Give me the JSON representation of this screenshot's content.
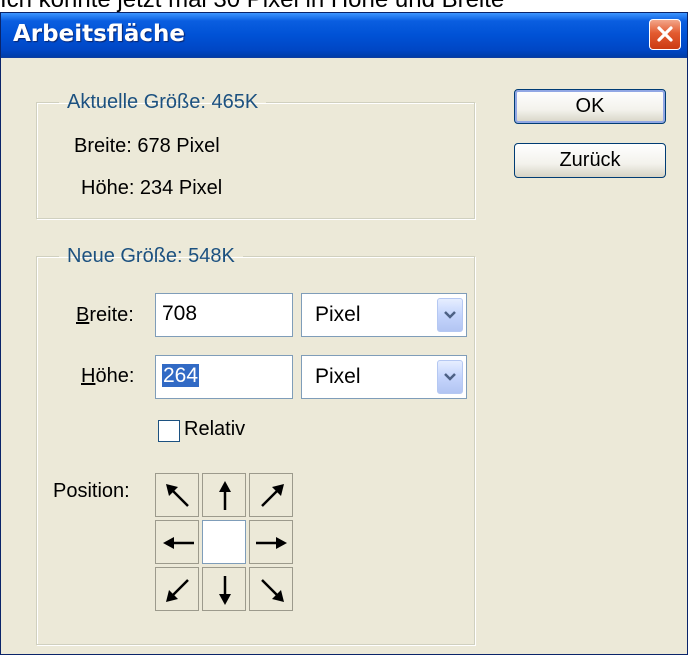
{
  "caption_partial": "Ich könnte jetzt mal 30 Pixel in Höhe und Breite",
  "dialog": {
    "title": "Arbeitsfläche",
    "close_icon": "close-x-icon"
  },
  "current_size": {
    "legend": "Aktuelle Größe: 465K",
    "width_text": "Breite: 678 Pixel",
    "height_text": "Höhe: 234 Pixel"
  },
  "new_size": {
    "legend": "Neue Größe: 548K",
    "width_label_mnemonic": "B",
    "width_label_rest": "reite:",
    "width_value": "708",
    "width_unit": "Pixel",
    "height_label_mnemonic": "H",
    "height_label_rest": "öhe:",
    "height_value": "264",
    "height_unit": "Pixel",
    "relative_label": "Relativ",
    "relative_checked": false
  },
  "position": {
    "label": "Position:",
    "anchor": "center"
  },
  "buttons": {
    "ok": "OK",
    "back": "Zurück"
  },
  "colors": {
    "titlebar": "#0052d6",
    "dialog_bg": "#ece9d8",
    "legend_text": "#1c5180",
    "selection": "#316ac5"
  }
}
